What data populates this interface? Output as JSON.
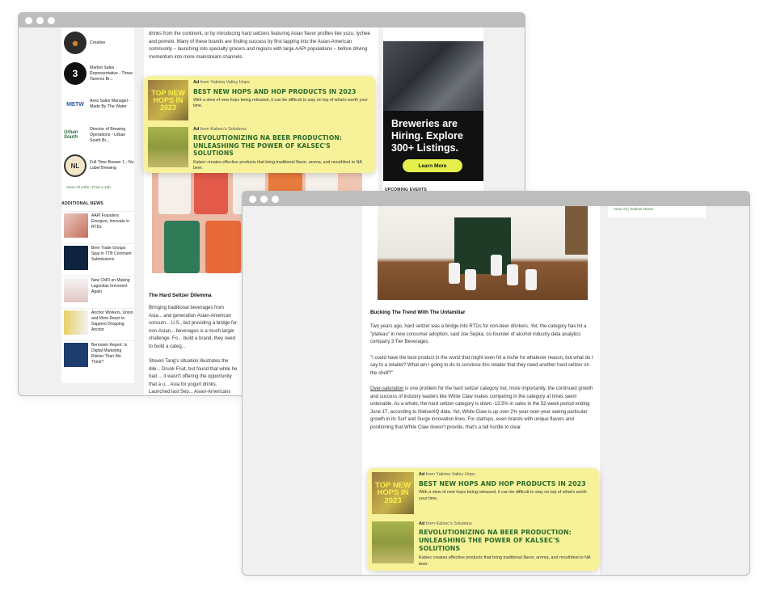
{
  "window1": {
    "jobs": [
      {
        "logo": "creative-logo",
        "title": "Creative"
      },
      {
        "logo": "three-taverns-logo",
        "title": "Market Sales Representative - Three Taverns Br..."
      },
      {
        "logo": "mbtw-logo",
        "logo_text": "MBTW",
        "title": "Area Sales Manager - Made By The Water"
      },
      {
        "logo": "urban-south-logo",
        "logo_text": "Urban South",
        "title": "Director of Brewing Operations - Urban South Br..."
      },
      {
        "logo": "no-label-logo",
        "logo_text": "NL",
        "title": "Full Time Brewer 1 - No Label Brewing"
      }
    ],
    "jobs_links": {
      "view_all": "View All Jobs",
      "sep": "|",
      "post": "Post a Job"
    },
    "additional_news_heading": "ADDITIONAL NEWS",
    "news": [
      {
        "title": "AAPI Founders Energize, Innovate in RTDs"
      },
      {
        "title": "Beer Trade Groups Spar in TTB Comment Submissions"
      },
      {
        "title": "New CMO on Making Lagunitas Irreverent Again"
      },
      {
        "title": "Anchor Workers, Union and More React to Sapporo Dropping Anchor"
      },
      {
        "title": "Bernstein Report: Is Digital Marketing Riskier Than We Think?"
      }
    ],
    "article_intro": "drinks from the continent, or by introducing hard seltzers featuring Asian flavor profiles like yuzu, lychee and pomelo. Many of these brands are finding success by first tapping into the Asian-American community – launching into specialty grocers and regions with large AAPI populations – before driving momentum into more mainstream channels.",
    "section_heading": "The Hard Seltzer Dilemma",
    "para1": "Bringing traditional beverages from Asia... and generation Asian-American consum... U.S., but providing a bridge for non-Asian... beverages is a much larger challenge. Fo... build a brand, they need to build a categ...",
    "para2": "Steven Tang's situation illustrates the dile... Drunk Fruit, but found that while he had ... it wasn't offering the opportunity that a u... Asia for yogurt drinks. Launched last Sep... Asian-Americans familiarity with yogurt d... more familiar with some of them – thanks...",
    "hiring": {
      "text": "Breweries are Hiring. Explore 300+ Listings.",
      "button": "Learn More"
    },
    "upcoming_heading": "UPCOMING EVENTS"
  },
  "ads": [
    {
      "image_text": "TOP NEW HOPS IN 2023",
      "label": "Ad",
      "from": "from Yakima Valley Hops",
      "title": "BEST NEW HOPS AND HOP PRODUCTS IN 2023",
      "desc": "With a slew of new hops being released, it can be difficult to stay on top of what's worth your time."
    },
    {
      "image_text": "",
      "label": "Ad",
      "from": "from Kalsec's Solutions",
      "title": "REVOLUTIONIZING NA BEER PRODUCTION: UNLEASHING THE POWER OF KALSEC'S SOLUTIONS",
      "desc": "Kalsec creates effective products that bring traditional flavor, aroma, and mouthfeel to NA beer."
    }
  ],
  "window2": {
    "rail_links": {
      "view_all": "View All",
      "sep": "|",
      "submit": "Submit News"
    },
    "heading": "Bucking The Trend With The Unfamiliar",
    "p1": "Two years ago, hard seltzer was a bridge into RTDs for non-beer drinkers. Yet, the category has hit a \"plateau\" in new consumer adoption, said Joe Sepka, co-founder of alcohol industry data analytics company 3 Tier Beverages.",
    "p2": "\"I could have the best product in the world that might even hit a niche for whatever reason, but what do I say to a retailer? What am I going to do to convince this retailer that they need another hard seltzer on the shelf?\"",
    "p3_link": "Over-saturation",
    "p3": " is one problem for the hard seltzer category but, more importantly, the continued growth and success of industry leaders like White Claw makes competing in the category at times seem untenable. As a whole, the hard seltzer category is down -13.5% in sales in the 52-week period ending June 17, according to NielsenIQ data. Yet, White Claw is up over 2% year-over-year seeing particular growth in its Surf and Surge innovation lines. For startups, even brands with unique flavors and positioning that White Claw doesn't provide, that's a tall hurdle to clear."
  },
  "colors": {
    "ad_bg": "#f7f29a",
    "ad_title": "#2a6a2a",
    "cta": "#e6f04d",
    "link": "#3d7a3d"
  }
}
